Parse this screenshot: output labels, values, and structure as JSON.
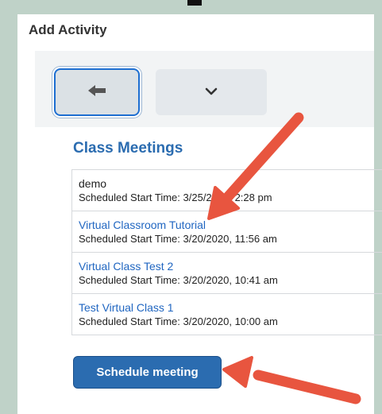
{
  "header": {
    "title": "Add Activity"
  },
  "toolbar": {
    "back_icon": "back-arrow-icon",
    "more_icon": "chevron-down-icon"
  },
  "section": {
    "title": "Class Meetings"
  },
  "meetings": [
    {
      "title": "demo",
      "time": "Scheduled Start Time: 3/25/2020, 2:28 pm",
      "link": false
    },
    {
      "title": "Virtual Classroom Tutorial",
      "time": "Scheduled Start Time: 3/20/2020, 11:56 am",
      "link": true
    },
    {
      "title": "Virtual Class Test 2",
      "time": "Scheduled Start Time: 3/20/2020, 10:41 am",
      "link": true
    },
    {
      "title": "Test Virtual Class 1",
      "time": "Scheduled Start Time: 3/20/2020, 10:00 am",
      "link": true
    }
  ],
  "actions": {
    "schedule_label": "Schedule meeting"
  },
  "colors": {
    "accent": "#2b6cb0",
    "annotation_arrow": "#e8553f"
  }
}
